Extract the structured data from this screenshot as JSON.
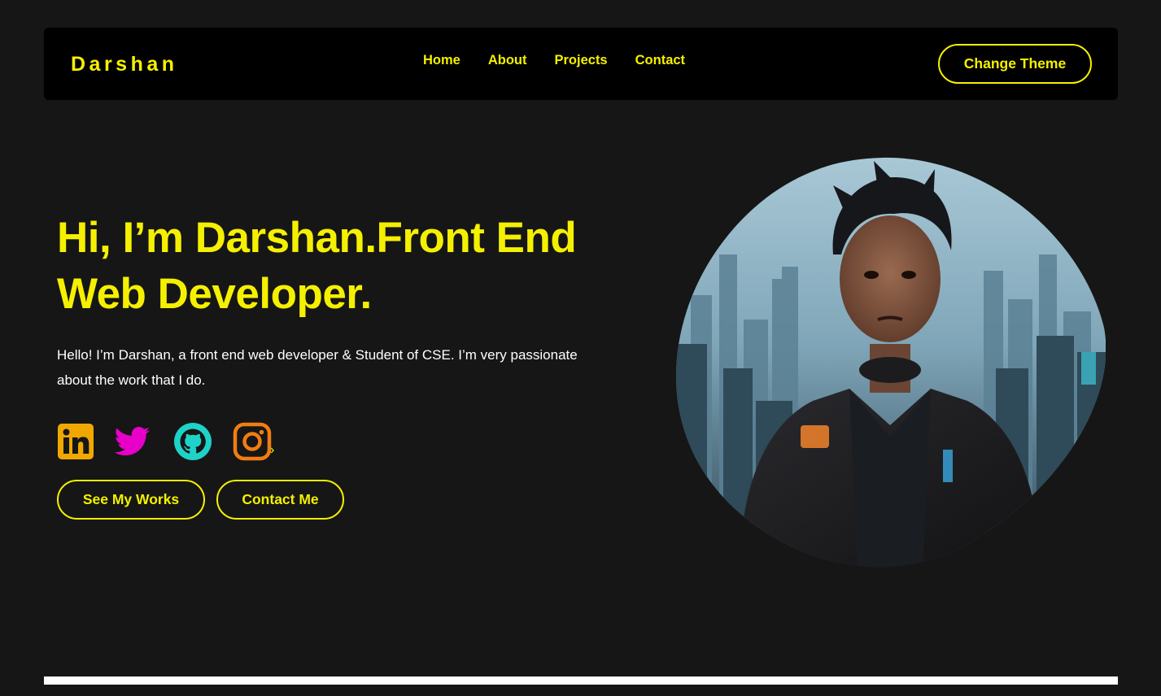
{
  "nav": {
    "brand": "Darshan",
    "links": [
      "Home",
      "About",
      "Projects",
      "Contact"
    ],
    "theme_button": "Change Theme"
  },
  "hero": {
    "title": "Hi, I’m Darshan.Front End Web Developer.",
    "description": "Hello! I’m Darshan, a front end web developer & Student of CSE. I’m very passionate about the work that I do.",
    "socials": [
      {
        "name": "linkedin-icon",
        "color": "#f0a800"
      },
      {
        "name": "twitter-icon",
        "color": "#e600c8"
      },
      {
        "name": "github-icon",
        "color": "#1ed2c8"
      },
      {
        "name": "instagram-icon",
        "color": "#f07d14"
      }
    ],
    "social_arrow": "›",
    "buttons": {
      "works": "See My Works",
      "contact": "Contact Me"
    }
  },
  "colors": {
    "accent": "#f5f000",
    "background": "#161616",
    "navbar": "#000000",
    "text": "#ffffff"
  }
}
